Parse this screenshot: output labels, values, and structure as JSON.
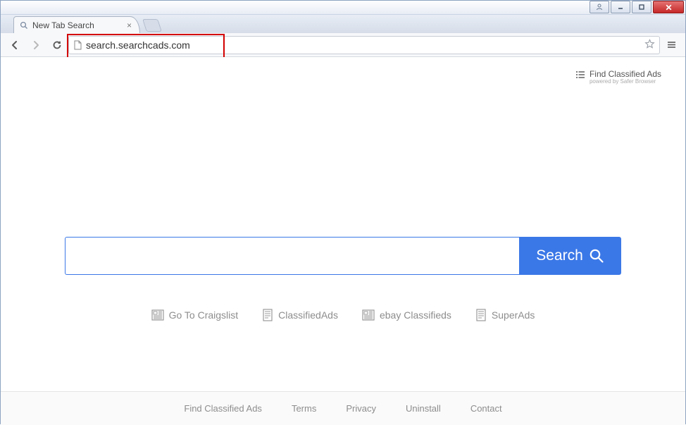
{
  "window": {
    "tab_title": "New Tab Search"
  },
  "toolbar": {
    "url": "search.searchcads.com"
  },
  "brand": {
    "title": "Find Classified Ads",
    "subtitle": "powered by Safer Browser"
  },
  "search": {
    "button_label": "Search",
    "input_value": ""
  },
  "quicklinks": [
    {
      "label": "Go To Craigslist"
    },
    {
      "label": "ClassifiedAds"
    },
    {
      "label": "ebay Classifieds"
    },
    {
      "label": "SuperAds"
    }
  ],
  "footer": [
    "Find Classified Ads",
    "Terms",
    "Privacy",
    "Uninstall",
    "Contact"
  ]
}
